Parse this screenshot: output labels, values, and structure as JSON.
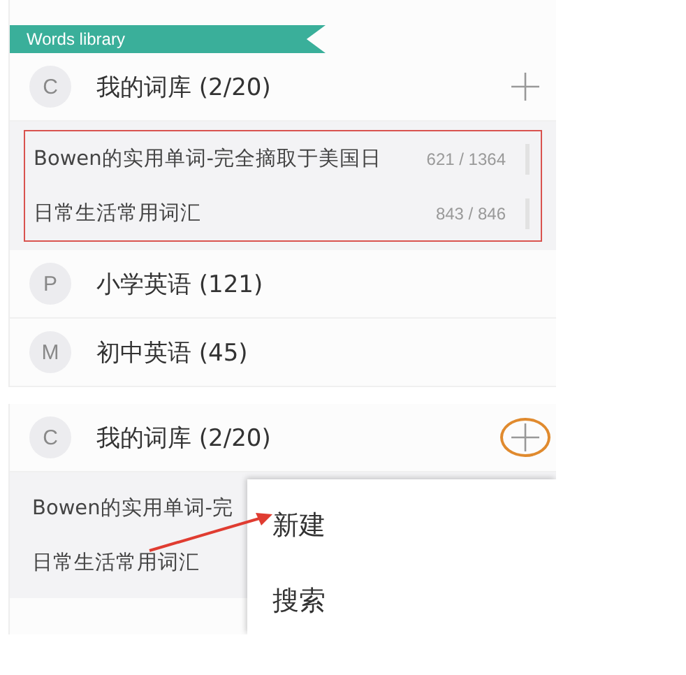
{
  "top_view": {
    "banner": "Words library",
    "my_library": {
      "initial": "C",
      "title": "我的词库 (2/20)"
    },
    "highlighted": true,
    "libraries": [
      {
        "name": "Bowen的实用单词-完全摘取于美国日",
        "count": "621 / 1364"
      },
      {
        "name": "日常生活常用词汇",
        "count": "843 / 846"
      }
    ],
    "categories": [
      {
        "initial": "P",
        "title": "小学英语 (121)"
      },
      {
        "initial": "M",
        "title": "初中英语 (45)"
      }
    ]
  },
  "bottom_view": {
    "my_library": {
      "initial": "C",
      "title": "我的词库 (2/20)"
    },
    "add_circled": true,
    "libraries": [
      {
        "name": "Bowen的实用单词-完"
      },
      {
        "name": "日常生活常用词汇"
      }
    ],
    "menu": [
      "新建",
      "搜索"
    ]
  }
}
